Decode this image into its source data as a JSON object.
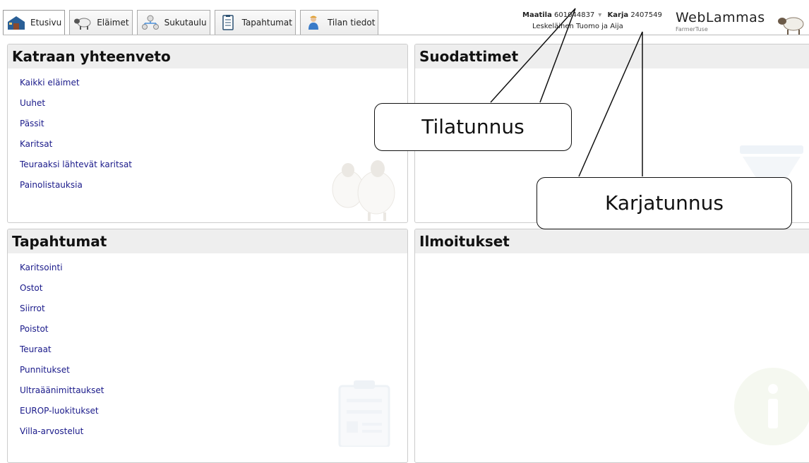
{
  "tabs": [
    {
      "label": "Etusivu",
      "icon": "barn-icon",
      "active": true
    },
    {
      "label": "Eläimet",
      "icon": "sheep-icon",
      "active": false
    },
    {
      "label": "Sukutaulu",
      "icon": "family-tree-icon",
      "active": false
    },
    {
      "label": "Tapahtumat",
      "icon": "clipboard-icon",
      "active": false
    },
    {
      "label": "Tilan tiedot",
      "icon": "farmer-icon",
      "active": false
    }
  ],
  "farm": {
    "maatila_label": "Maatila",
    "maatila_value": "601044837",
    "karja_label": "Karja",
    "karja_value": "2407549",
    "owner": "Leskeläinen Tuomo ja Aija"
  },
  "brand": {
    "name": "WebLammas",
    "tagline": "FarmerTuse"
  },
  "panels": {
    "flock": {
      "title": "Katraan yhteenveto",
      "links": [
        "Kaikki eläimet",
        "Uuhet",
        "Pässit",
        "Karitsat",
        "Teuraaksi lähtevät karitsat",
        "Painolistauksia"
      ]
    },
    "filters": {
      "title": "Suodattimet"
    },
    "events": {
      "title": "Tapahtumat",
      "links": [
        "Karitsointi",
        "Ostot",
        "Siirrot",
        "Poistot",
        "Teuraat",
        "Punnitukset",
        "Ultraäänimittaukset",
        "EUROP-luokitukset",
        "Villa-arvostelut"
      ]
    },
    "notices": {
      "title": "Ilmoitukset"
    }
  },
  "callouts": {
    "tilatunnus": "Tilatunnus",
    "karjatunnus": "Karjatunnus"
  }
}
